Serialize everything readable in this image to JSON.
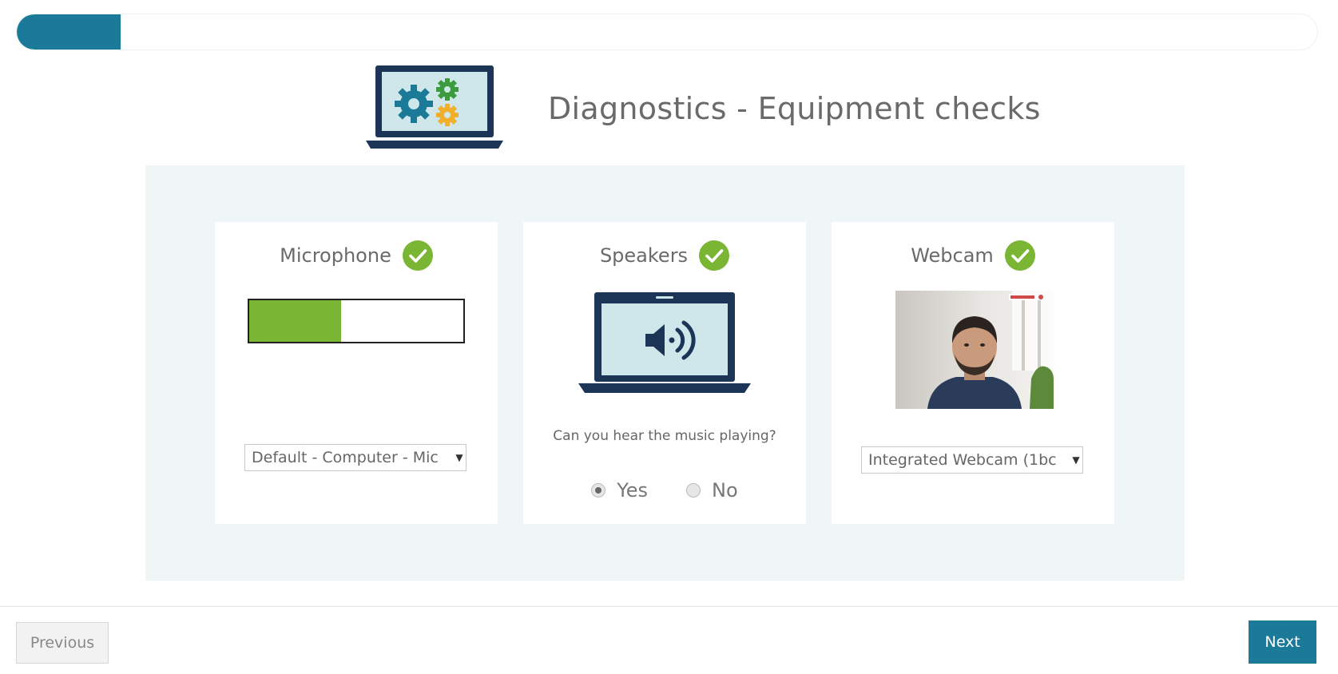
{
  "progress": {
    "fraction": 0.08,
    "color": "#1b7a98"
  },
  "header": {
    "title": "Diagnostics - Equipment checks",
    "icon": "laptop-gears-icon"
  },
  "microphone": {
    "title": "Microphone",
    "status_icon": "check-circle-icon",
    "level_fraction": 0.43,
    "device": "Default - Computer - Mic"
  },
  "speakers": {
    "title": "Speakers",
    "status_icon": "check-circle-icon",
    "icon": "laptop-speaker-icon",
    "question": "Can you hear the music playing?",
    "options": [
      {
        "label": "Yes",
        "checked": true
      },
      {
        "label": "No",
        "checked": false
      }
    ]
  },
  "webcam": {
    "title": "Webcam",
    "status_icon": "check-circle-icon",
    "device": "Integrated Webcam (1bc"
  },
  "footer": {
    "previous_label": "Previous",
    "next_label": "Next"
  },
  "colors": {
    "accent": "#1b7a98",
    "success": "#7ab534",
    "panel_bg": "#f0f6f6",
    "laptop_frame": "#1c3557",
    "laptop_screen": "#cfe7ea"
  }
}
